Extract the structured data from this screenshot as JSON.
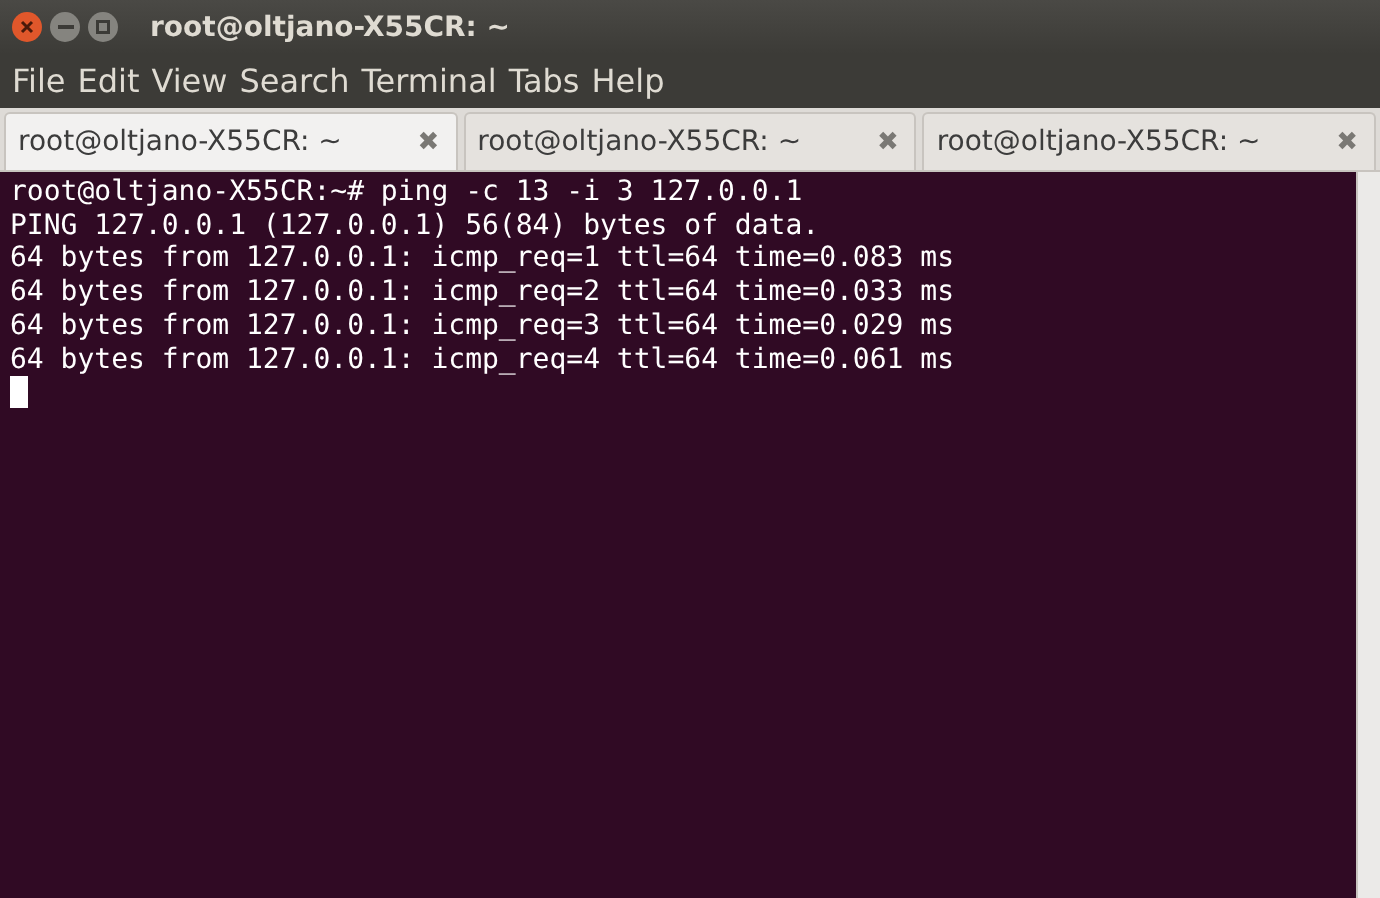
{
  "window": {
    "title": "root@oltjano-X55CR: ~"
  },
  "menu": [
    "File",
    "Edit",
    "View",
    "Search",
    "Terminal",
    "Tabs",
    "Help"
  ],
  "tabs": [
    {
      "label": "root@oltjano-X55CR: ~",
      "close": "✖",
      "selected": true
    },
    {
      "label": "root@oltjano-X55CR: ~",
      "close": "✖",
      "selected": false
    },
    {
      "label": "root@oltjano-X55CR: ~",
      "close": "✖",
      "selected": false
    }
  ],
  "terminal": {
    "lines": [
      "root@oltjano-X55CR:~# ping -c 13 -i 3 127.0.0.1",
      "PING 127.0.0.1 (127.0.0.1) 56(84) bytes of data.",
      "64 bytes from 127.0.0.1: icmp_req=1 ttl=64 time=0.083 ms",
      "64 bytes from 127.0.0.1: icmp_req=2 ttl=64 time=0.033 ms",
      "64 bytes from 127.0.0.1: icmp_req=3 ttl=64 time=0.029 ms",
      "64 bytes from 127.0.0.1: icmp_req=4 ttl=64 time=0.061 ms"
    ]
  }
}
